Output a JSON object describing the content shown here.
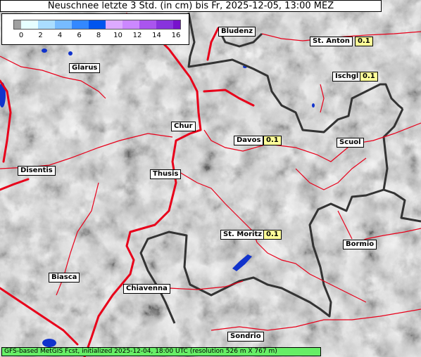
{
  "title": "Neuschnee letzte 3 Std. (in cm) bis Fr, 2025-12-05, 13:00 MEZ",
  "legend": {
    "colors": [
      "#a0a0a0",
      "#e6ffff",
      "#aaddff",
      "#77bbff",
      "#3388ff",
      "#0055ee",
      "#ddaaff",
      "#cc88ff",
      "#aa55ee",
      "#8833dd",
      "#7711cc"
    ],
    "ticks": [
      "0",
      "2",
      "4",
      "6",
      "8",
      "10",
      "12",
      "14",
      "16"
    ]
  },
  "places": [
    {
      "name": "Bludenz"
    },
    {
      "name": "St. Anton",
      "value": "0.1"
    },
    {
      "name": "Glarus"
    },
    {
      "name": "Ischgl",
      "value": "0.1"
    },
    {
      "name": "Chur"
    },
    {
      "name": "Davos",
      "value": "0.1"
    },
    {
      "name": "Scuol"
    },
    {
      "name": "Disentis"
    },
    {
      "name": "Thusis"
    },
    {
      "name": "St. Moritz",
      "value": "0.1"
    },
    {
      "name": "Bormio"
    },
    {
      "name": "Biasca"
    },
    {
      "name": "Chiavenna"
    },
    {
      "name": "Sondrio"
    }
  ],
  "footer": "GFS-based MetGIS Fcst, initialized 2025-12-04, 18:00 UTC  (resolution 526 m X 767 m)"
}
